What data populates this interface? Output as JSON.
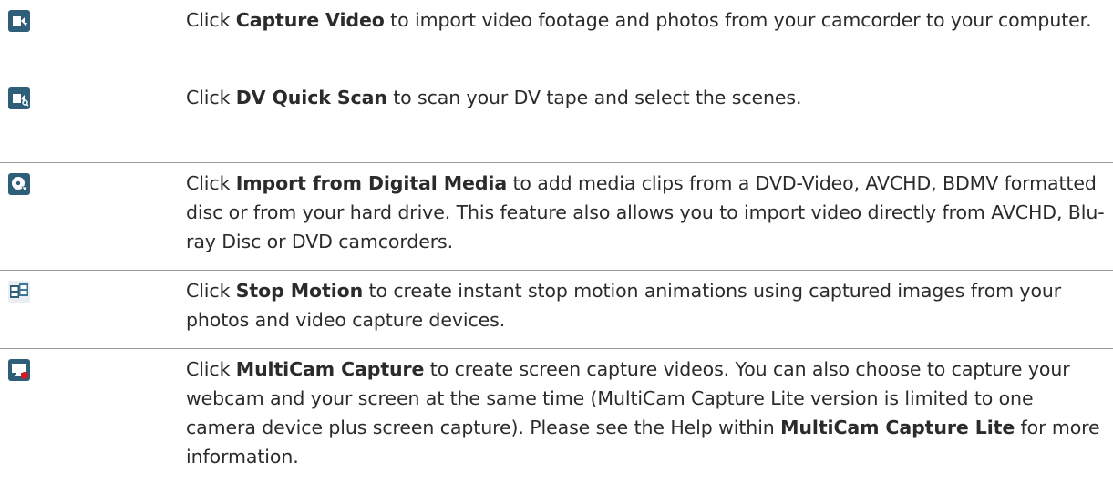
{
  "colors": {
    "icon_bg": "#2f5e78",
    "icon_fg": "#ffffff",
    "record_dot": "#e0141e",
    "rule": "#9a9a9a",
    "text": "#2b2b2b"
  },
  "rows": [
    {
      "icon": "capture-video-icon",
      "before": "Click ",
      "bold": "Capture Video",
      "after": " to import video footage and photos from your camcorder to your computer."
    },
    {
      "icon": "dv-quick-scan-icon",
      "before": "Click ",
      "bold": "DV Quick Scan",
      "after": " to scan your DV tape and select the scenes."
    },
    {
      "icon": "import-digital-media-icon",
      "before": "Click ",
      "bold": "Import from Digital Media",
      "after": " to add media clips from a DVD-Video, AVCHD, BDMV formatted disc or from your hard drive. This feature also allows you to import video directly from AVCHD, Blu-ray Disc or DVD camcorders."
    },
    {
      "icon": "stop-motion-icon",
      "before": "Click ",
      "bold": "Stop Motion",
      "after": " to create instant stop motion animations using captured images from your photos and video capture devices."
    },
    {
      "icon": "multicam-capture-icon",
      "before": "Click ",
      "bold": "MultiCam Capture",
      "after": " to create screen capture videos. You can also choose to capture your webcam and your screen at the same time (MultiCam Capture Lite version is limited to one camera device plus screen capture). Please see the Help within ",
      "bold2": "MultiCam Capture Lite",
      "after2": " for more information."
    }
  ]
}
